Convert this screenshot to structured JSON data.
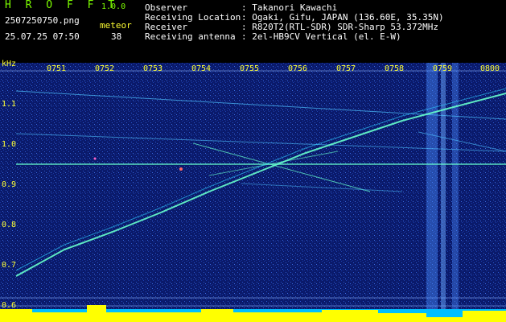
{
  "header": {
    "app_title": "H R O F F T",
    "app_version": "1.0.0",
    "filename": "2507250750.png",
    "datetime": "25.07.25 07:50",
    "meteor_label": "meteor",
    "meteor_count": "38",
    "info": [
      {
        "key": "Observer",
        "value": ": Takanori Kawachi"
      },
      {
        "key": "Receiving Location",
        "value": ": Ogaki, Gifu, JAPAN (136.60E, 35.35N)"
      },
      {
        "key": "Receiver",
        "value": ": R820T2(RTL-SDR) SDR-Sharp 53.372MHz"
      },
      {
        "key": "Receiving antenna",
        "value": ": 2el-HB9CV Vertical (el. E-W)"
      }
    ]
  },
  "axis": {
    "unit": "kHz",
    "time_ticks": [
      "0751",
      "0752",
      "0753",
      "0754",
      "0755",
      "0756",
      "0757",
      "0758",
      "0759",
      "0800"
    ],
    "freq_ticks": [
      "1.1",
      "1.0",
      "0.9",
      "0.8",
      "0.7",
      "0.6"
    ]
  },
  "colors": {
    "label": "#ffff33",
    "background": "#000000",
    "spectrogram_bg": "#0a1a6b",
    "signal": "#66ffcc",
    "level_fill": "#ffff00",
    "level_base": "#00bfff"
  }
}
